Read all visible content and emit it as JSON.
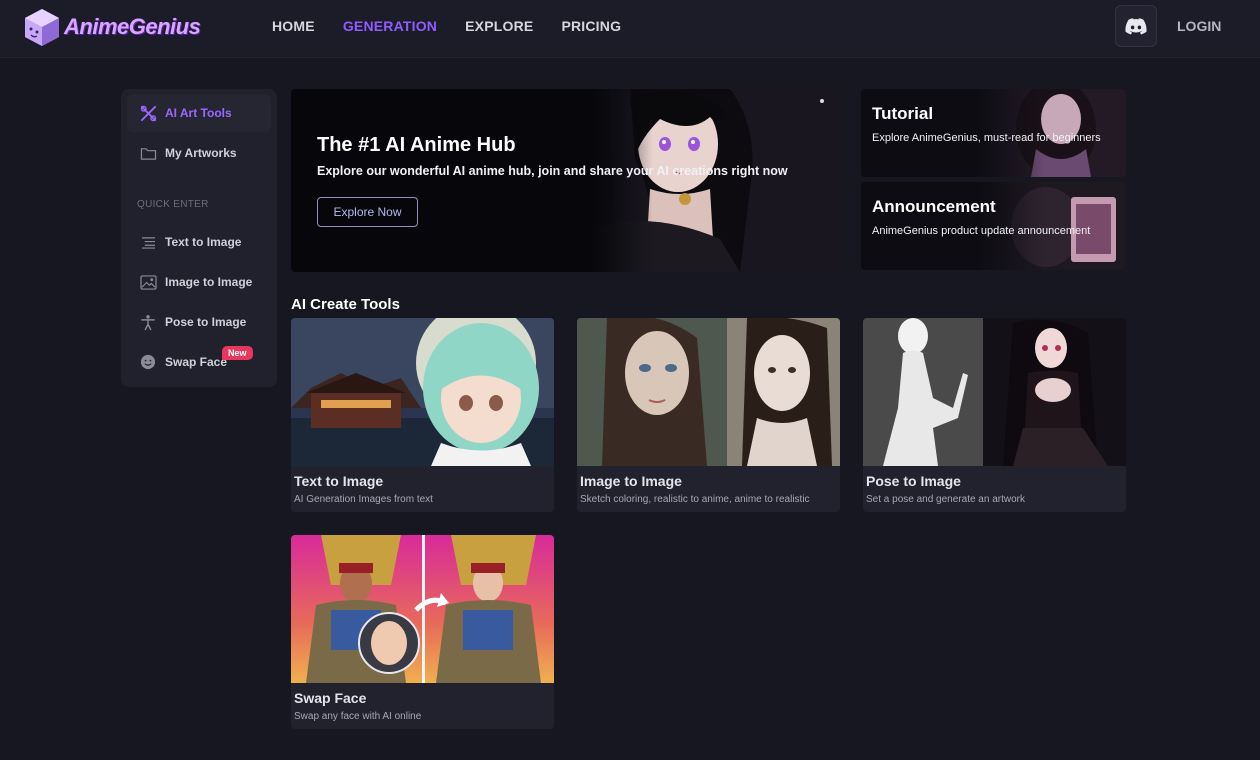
{
  "brand": {
    "name": "AnimeGenius"
  },
  "nav": {
    "items": [
      {
        "label": "HOME",
        "active": false
      },
      {
        "label": "GENERATION",
        "active": true
      },
      {
        "label": "EXPLORE",
        "active": false
      },
      {
        "label": "PRICING",
        "active": false
      }
    ],
    "login": "LOGIN"
  },
  "sidebar": {
    "ai_art_tools": "AI Art Tools",
    "my_artworks": "My Artworks",
    "quick_enter": "QUICK ENTER",
    "items": [
      {
        "label": "Text to Image",
        "icon": "text-lines-icon"
      },
      {
        "label": "Image to Image",
        "icon": "image-icon"
      },
      {
        "label": "Pose to Image",
        "icon": "person-pose-icon"
      },
      {
        "label": "Swap Face",
        "icon": "face-icon"
      }
    ],
    "new_badge": "New"
  },
  "hero": {
    "title": "The #1 AI Anime Hub",
    "subtitle": "Explore our wonderful AI anime hub, join and share your AI creations right now",
    "button": "Explore Now"
  },
  "cards": [
    {
      "title": "Tutorial",
      "subtitle": "Explore AnimeGenius, must-read for beginners"
    },
    {
      "title": "Announcement",
      "subtitle": "AnimeGenius product update announcement"
    }
  ],
  "section_title": "AI Create Tools",
  "tools": [
    {
      "title": "Text to Image",
      "subtitle": "AI Generation Images from text"
    },
    {
      "title": "Image to Image",
      "subtitle": "Sketch coloring, realistic to anime, anime to realistic"
    },
    {
      "title": "Pose to Image",
      "subtitle": "Set a pose and generate an artwork"
    },
    {
      "title": "Swap Face",
      "subtitle": "Swap any face with AI online"
    }
  ],
  "colors": {
    "accent": "#8f5cff",
    "background": "#171721",
    "panel": "#21212d",
    "badge": "#e8365d"
  }
}
